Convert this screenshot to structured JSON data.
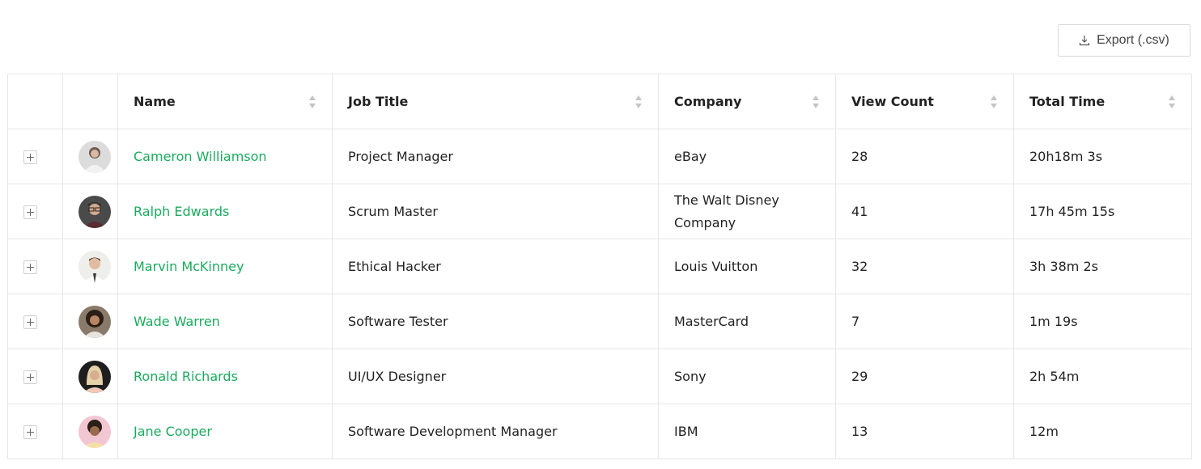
{
  "toolbar": {
    "export_label": "Export (.csv)"
  },
  "table": {
    "columns": [
      "Name",
      "Job Title",
      "Company",
      "View Count",
      "Total Time"
    ],
    "rows": [
      {
        "name": "Cameron Williamson",
        "job_title": "Project Manager",
        "company": "eBay",
        "view_count": "28",
        "total_time": "20h18m 3s"
      },
      {
        "name": "Ralph Edwards",
        "job_title": "Scrum Master",
        "company": "The Walt Disney Company",
        "view_count": "41",
        "total_time": "17h 45m 15s"
      },
      {
        "name": "Marvin McKinney",
        "job_title": "Ethical Hacker",
        "company": "Louis Vuitton",
        "view_count": "32",
        "total_time": "3h 38m 2s"
      },
      {
        "name": "Wade Warren",
        "job_title": "Software Tester",
        "company": "MasterCard",
        "view_count": "7",
        "total_time": "1m 19s"
      },
      {
        "name": "Ronald Richards",
        "job_title": "UI/UX Designer",
        "company": "Sony",
        "view_count": "29",
        "total_time": "2h 54m"
      },
      {
        "name": "Jane Cooper",
        "job_title": "Software Development Manager",
        "company": "IBM",
        "view_count": "13",
        "total_time": "12m"
      }
    ]
  },
  "colors": {
    "link": "#1aab5d",
    "border": "#e6e6e6"
  }
}
